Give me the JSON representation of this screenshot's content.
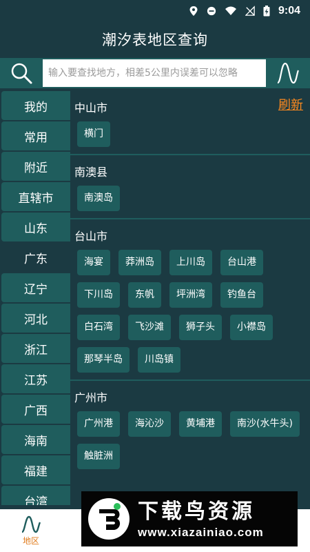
{
  "status_bar": {
    "time": "9:04"
  },
  "header": {
    "title": "潮汐表地区查询"
  },
  "search": {
    "placeholder": "输入要查找地方，相差5公里内误差可以忽略"
  },
  "refresh_label": "刷新",
  "sidebar": {
    "items": [
      {
        "label": "我的"
      },
      {
        "label": "常用"
      },
      {
        "label": "附近"
      },
      {
        "label": "直辖市"
      },
      {
        "label": "山东"
      },
      {
        "label": "广东"
      },
      {
        "label": "辽宁"
      },
      {
        "label": "河北"
      },
      {
        "label": "浙江"
      },
      {
        "label": "江苏"
      },
      {
        "label": "广西"
      },
      {
        "label": "海南"
      },
      {
        "label": "福建"
      },
      {
        "label": "台湾"
      }
    ],
    "active_label": "广东"
  },
  "groups": [
    {
      "title": "中山市",
      "places": [
        "横门"
      ]
    },
    {
      "title": "南澳县",
      "places": [
        "南澳岛"
      ]
    },
    {
      "title": "台山市",
      "places": [
        "海宴",
        "莽洲岛",
        "上川岛",
        "台山港",
        "下川岛",
        "东帆",
        "坪洲湾",
        "钓鱼台",
        "白石湾",
        "飞沙滩",
        "狮子头",
        "小襟岛",
        "那琴半岛",
        "川岛镇"
      ]
    },
    {
      "title": "广州市",
      "places": [
        "广州港",
        "海沁沙",
        "黄埔港",
        "南沙(水牛头)",
        "触脏洲"
      ]
    }
  ],
  "bottom_nav": {
    "tab_label": "地区"
  },
  "watermark": {
    "brand": "下载鸟资源",
    "url": "www.xiazainiao.com"
  },
  "colors": {
    "background": "#1b3a42",
    "accent_teal": "#1f5d5d",
    "refresh_orange": "#ff8a1e",
    "tab_active_orange": "#e07a1a"
  }
}
